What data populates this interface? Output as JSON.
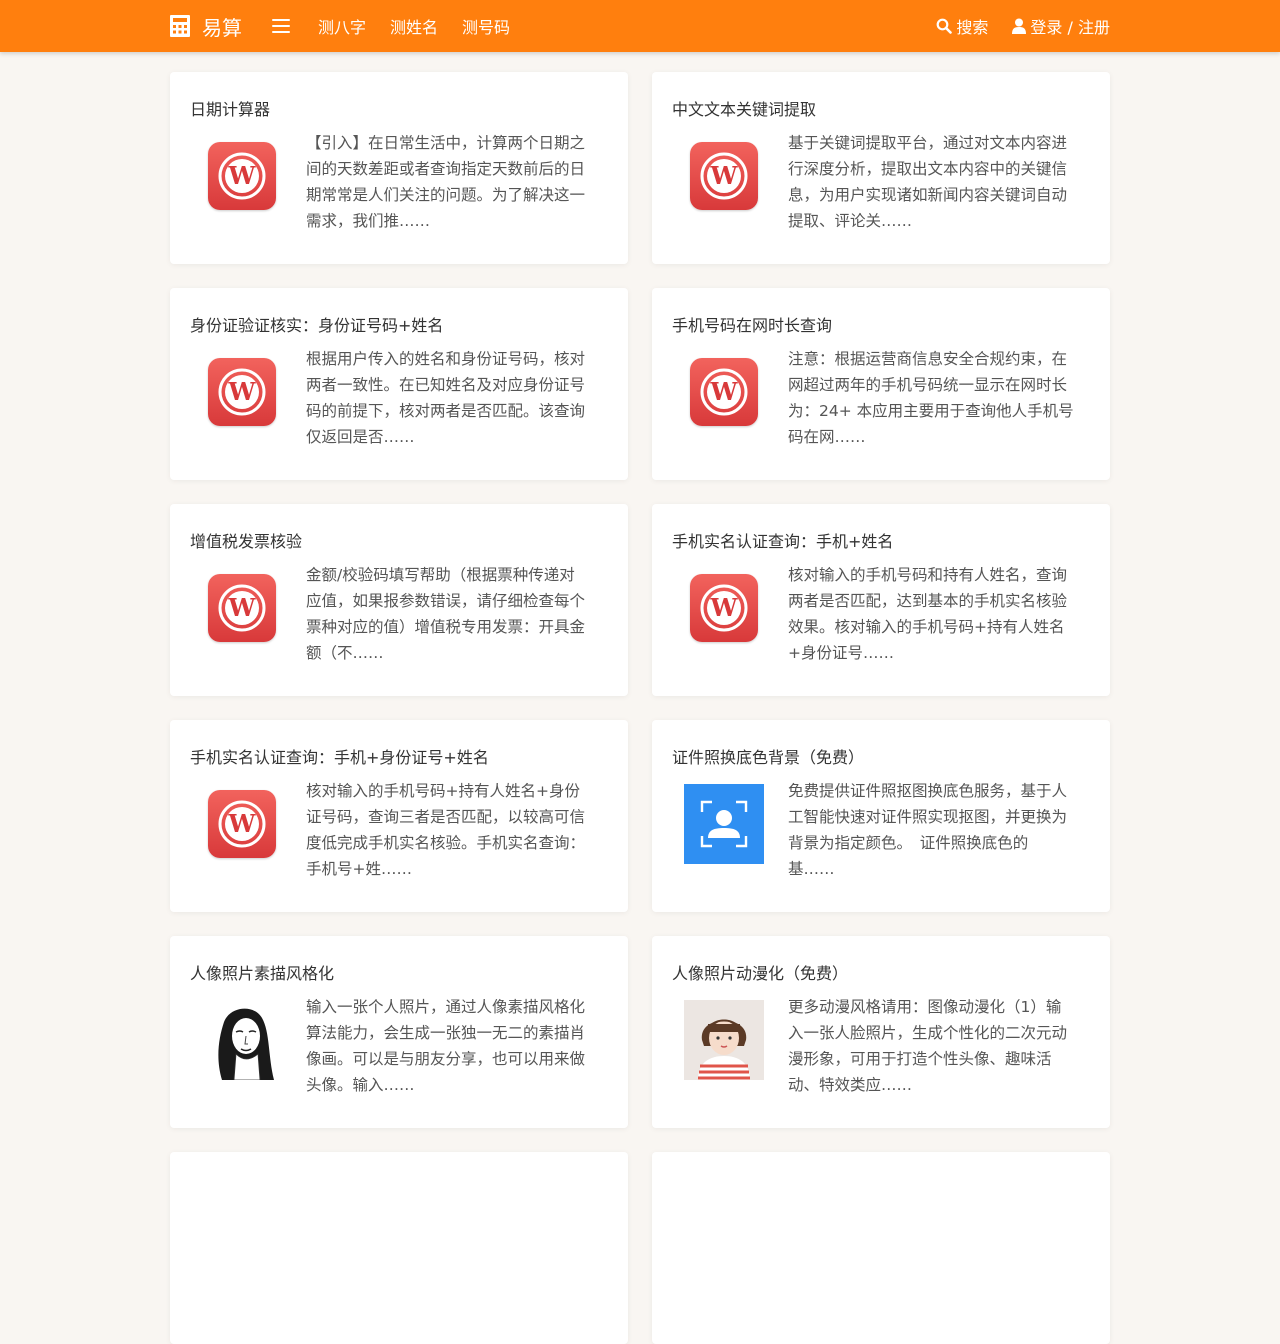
{
  "header": {
    "brand": "易算",
    "brand_icon": "calculator-icon",
    "menu_icon": "hamburger-menu-icon",
    "nav": [
      "测八字",
      "测姓名",
      "测号码"
    ],
    "search_label": "搜索",
    "login_label": "登录 / 注册",
    "accent_color": "#ff7f0e"
  },
  "cards": [
    {
      "title": "日期计算器",
      "thumb": "wordpress-icon",
      "desc": [
        "【引入】在日常生活中，计算两个日期之",
        "间的天数差距或者查询指定天数前后的日",
        "期常常是人们关注的问题。为了解决这一",
        "需求，我们推……"
      ]
    },
    {
      "title": "中文文本关键词提取",
      "thumb": "wordpress-icon",
      "desc": [
        "基于关键词提取平台，通过对文本内容进",
        "行深度分析，提取出文本内容中的关键信",
        "息，为用户实现诸如新闻内容关键词自动",
        "提取、评论关……"
      ]
    },
    {
      "title": "身份证验证核实：身份证号码+姓名",
      "thumb": "wordpress-icon",
      "desc": [
        "根据用户传入的姓名和身份证号码，核对",
        "两者一致性。在已知姓名及对应身份证号",
        "码的前提下，核对两者是否匹配。该查询",
        "仅返回是否……"
      ]
    },
    {
      "title": "手机号码在网时长查询",
      "thumb": "wordpress-icon",
      "desc": [
        "注意：根据运营商信息安全合规约束，在",
        "网超过两年的手机号码统一显示在网时长",
        "为：24+ 本应用主要用于查询他人手机号",
        "码在网……"
      ]
    },
    {
      "title": "增值税发票核验",
      "thumb": "wordpress-icon",
      "desc": [
        "金额/校验码填写帮助（根据票种传递对",
        "应值，如果报参数错误，请仔细检查每个",
        "票种对应的值）增值税专用发票：开具金",
        "额（不……"
      ]
    },
    {
      "title": "手机实名认证查询：手机+姓名",
      "thumb": "wordpress-icon",
      "desc": [
        "核对输入的手机号码和持有人姓名，查询",
        "两者是否匹配，达到基本的手机实名核验",
        "效果。核对输入的手机号码+持有人姓名",
        "+身份证号……"
      ]
    },
    {
      "title": "手机实名认证查询：手机+身份证号+姓名",
      "thumb": "wordpress-icon",
      "desc": [
        "核对输入的手机号码+持有人姓名+身份",
        "证号码，查询三者是否匹配，以较高可信",
        "度低完成手机实名核验。手机实名查询：",
        "手机号+姓……"
      ]
    },
    {
      "title": "证件照换底色背景（免费）",
      "thumb": "id-photo-icon",
      "desc": [
        "免费提供证件照抠图换底色服务，基于人",
        "工智能快速对证件照实现抠图，并更换为",
        "背景为指定颜色。　证件照换底色的",
        "基……"
      ]
    },
    {
      "title": "人像照片素描风格化",
      "thumb": "sketch-portrait-image",
      "desc": [
        "输入一张个人照片，通过人像素描风格化",
        "算法能力，会生成一张独一无二的素描肖",
        "像画。可以是与朋友分享，也可以用来做",
        "头像。输入……"
      ]
    },
    {
      "title": "人像照片动漫化（免费）",
      "thumb": "anime-portrait-image",
      "desc": [
        "更多动漫风格请用：图像动漫化（1）输",
        "入一张人脸照片，生成个性化的二次元动",
        "漫形象，可用于打造个性头像、趣味活",
        "动、特效类应……"
      ]
    }
  ]
}
